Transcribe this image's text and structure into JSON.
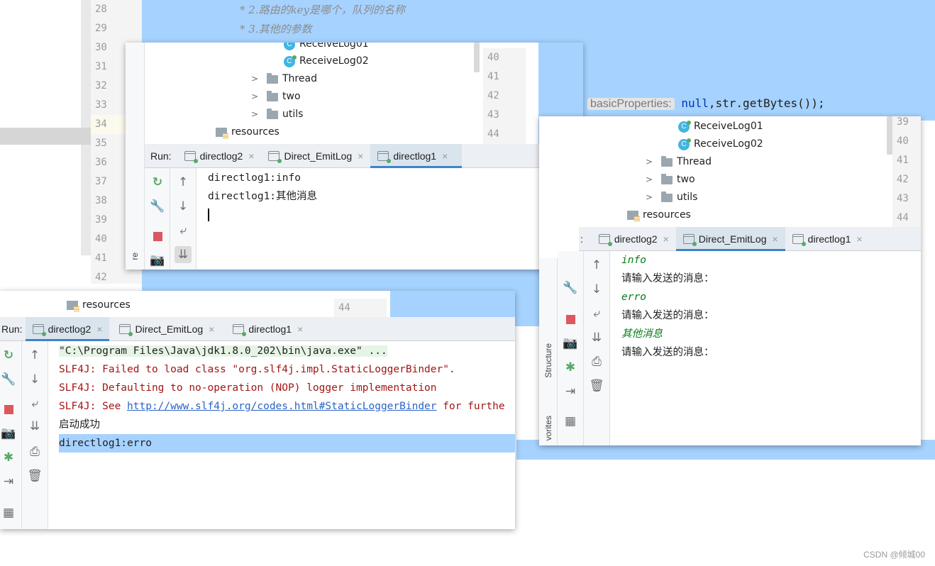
{
  "editor": {
    "line_numbers": [
      "28",
      "29",
      "30",
      "31",
      "32",
      "33",
      "34",
      "35",
      "36",
      "37",
      "38",
      "39",
      "40",
      "41",
      "42"
    ],
    "comment_line_1": "* 2.路由的key是哪个，队列的名称",
    "comment_line_2": "* 3.其他的参数",
    "param_hint": "basicProperties:",
    "code_null": "null",
    "code_rest": ",str.getBytes());"
  },
  "window_a": {
    "tree": {
      "partial_item": "ReceiveLog01",
      "items": [
        "ReceiveLog02",
        "Thread",
        "two",
        "utils",
        "resources"
      ]
    },
    "line_numbers": [
      "40",
      "41",
      "42",
      "43",
      "44"
    ],
    "run_label": "Run:",
    "tabs": [
      "directlog2",
      "Direct_EmitLog",
      "directlog1"
    ],
    "active_tab": "directlog1",
    "console": [
      "directlog1:info",
      "directlog1:其他消息"
    ],
    "side_label": "re"
  },
  "window_b": {
    "tree": {
      "items": [
        "ReceiveLog01",
        "ReceiveLog02",
        "Thread",
        "two",
        "utils",
        "resources"
      ]
    },
    "line_numbers": [
      "39",
      "40",
      "41",
      "42",
      "43",
      "44"
    ],
    "run_label": ":",
    "tabs": [
      "directlog2",
      "Direct_EmitLog",
      "directlog1"
    ],
    "active_tab": "Direct_EmitLog",
    "console": [
      {
        "text": "info",
        "kind": "input"
      },
      {
        "text": "请输入发送的消息：",
        "kind": "prompt"
      },
      {
        "text": "erro",
        "kind": "input"
      },
      {
        "text": "请输入发送的消息：",
        "kind": "prompt"
      },
      {
        "text": "其他消息",
        "kind": "input"
      },
      {
        "text": "请输入发送的消息：",
        "kind": "prompt"
      }
    ],
    "side_labels": {
      "structure": "Structure",
      "favorites": "vorites"
    }
  },
  "window_c": {
    "tree": {
      "items": [
        "resources"
      ]
    },
    "line_numbers": [
      "44"
    ],
    "run_label": "Run:",
    "tabs": [
      "directlog2",
      "Direct_EmitLog",
      "directlog1"
    ],
    "active_tab": "directlog2",
    "console": {
      "cmd": "\"C:\\Program Files\\Java\\jdk1.8.0_202\\bin\\java.exe\" ...",
      "err1": "SLF4J: Failed to load class \"org.slf4j.impl.StaticLoggerBinder\".",
      "err2": "SLF4J: Defaulting to no-operation (NOP) logger implementation",
      "err3_prefix": "SLF4J: See ",
      "err3_link": "http://www.slf4j.org/codes.html#StaticLoggerBinder",
      "err3_suffix": " for furthe",
      "started": "启动成功",
      "received": "directlog1:erro"
    }
  },
  "watermark": "CSDN @倾城00",
  "colors": {
    "selection": "#a6d2ff",
    "error_text": "#a31515",
    "input_text": "#067d17",
    "link": "#2a64c4",
    "active_tab_underline": "#4083c9"
  }
}
